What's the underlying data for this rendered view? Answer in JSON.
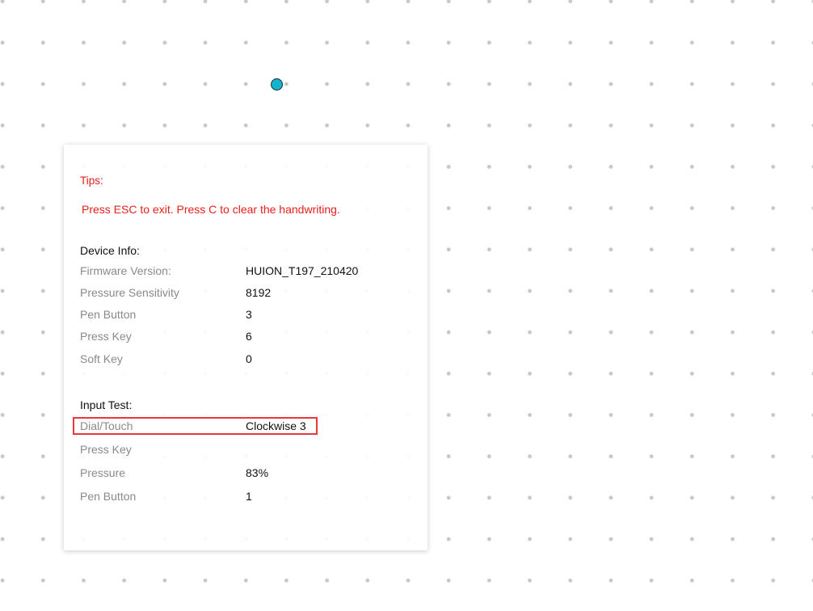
{
  "tips": {
    "title": "Tips:",
    "text": "Press ESC to exit. Press C to clear the handwriting."
  },
  "device_info": {
    "title": "Device Info:",
    "rows": [
      {
        "label": "Firmware Version:",
        "value": "HUION_T197_210420"
      },
      {
        "label": "Pressure Sensitivity",
        "value": "8192"
      },
      {
        "label": "Pen Button",
        "value": "3"
      },
      {
        "label": "Press Key",
        "value": "6"
      },
      {
        "label": "Soft Key",
        "value": "0"
      }
    ]
  },
  "input_test": {
    "title": "Input Test:",
    "rows": [
      {
        "label": "Dial/Touch",
        "value": "Clockwise 3"
      },
      {
        "label": "Press Key",
        "value": ""
      },
      {
        "label": "Pressure",
        "value": "83%"
      },
      {
        "label": "Pen Button",
        "value": "1"
      }
    ]
  },
  "colors": {
    "tips": "#e8201c",
    "highlight": "#e8383c",
    "pen_cursor": "#14b4d0",
    "dot_grid": "#c8c8c8"
  }
}
